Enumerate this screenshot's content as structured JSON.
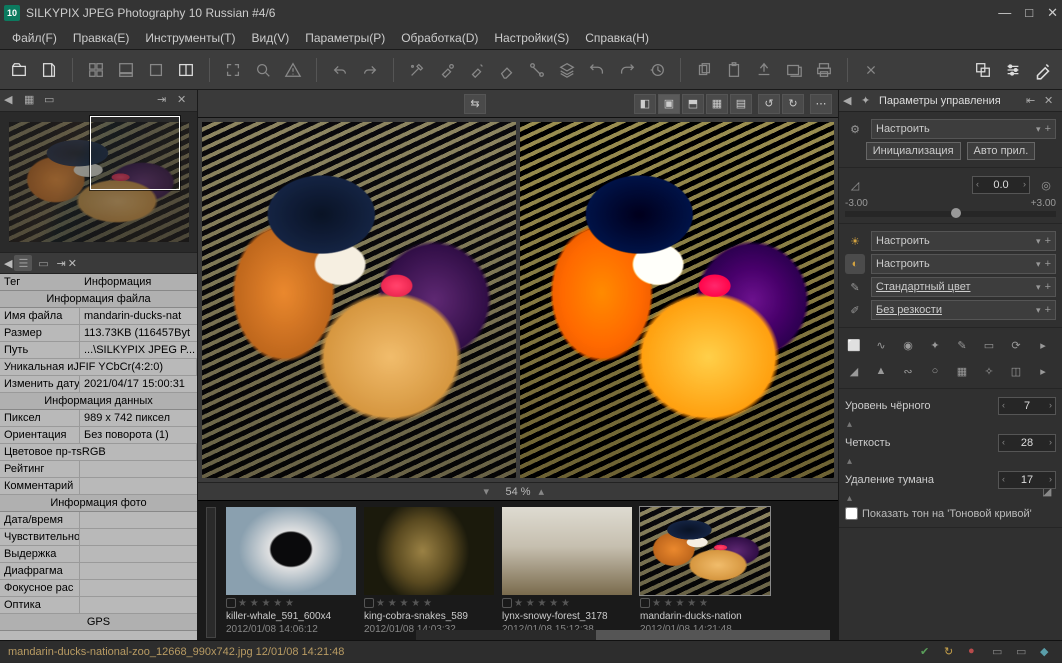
{
  "title": "SILKYPIX JPEG Photography 10 Russian   #4/6",
  "app_badge": "10",
  "menu": {
    "file": "Файл(F)",
    "edit": "Правка(E)",
    "tools": "Инструменты(T)",
    "view": "Вид(V)",
    "params": "Параметры(P)",
    "process": "Обработка(D)",
    "settings": "Настройки(S)",
    "help": "Справка(H)"
  },
  "zoom": {
    "value": "54",
    "unit": "%"
  },
  "info": {
    "col1": "Тег",
    "col2": "Информация",
    "sec_file": "Информация файла",
    "filename_k": "Имя файла",
    "filename_v": "mandarin-ducks-nat",
    "size_k": "Размер",
    "size_v": "113.73KB (116457Byt",
    "path_k": "Путь",
    "path_v": "...\\SILKYPIX JPEG P...",
    "uniq_k": "Уникальная иJFIF YCbCr(4:2:0)",
    "uniq_v": "",
    "mdate_k": "Изменить дату",
    "mdate_v": "2021/04/17 15:00:31",
    "sec_data": "Информация данных",
    "px_k": "Пиксел",
    "px_v": "989 x 742 пиксел",
    "orient_k": "Ориентация",
    "orient_v": "Без поворота (1)",
    "cs_k": "Цветовое пр-тsRGB",
    "cs_v": "",
    "rating_k": "Рейтинг",
    "rating_v": "",
    "comment_k": "Комментарий",
    "comment_v": "",
    "sec_photo": "Информация фото",
    "dt_k": "Дата/время",
    "dt_v": "",
    "sens_k": "Чувствительно",
    "sens_v": "",
    "exp_k": "Выдержка",
    "exp_v": "",
    "ap_k": "Диафрагма",
    "ap_v": "",
    "foc_k": "Фокусное рас",
    "foc_v": "",
    "opt_k": "Оптика",
    "opt_v": "",
    "sec_gps": "GPS"
  },
  "strip": [
    {
      "name": "killer-whale_591_600x4",
      "date": "2012/01/08 14:06:12"
    },
    {
      "name": "king-cobra-snakes_589",
      "date": "2012/01/08 14:03:32"
    },
    {
      "name": "lynx-snowy-forest_3178",
      "date": "2012/01/08 15:12:38"
    },
    {
      "name": "mandarin-ducks-nation",
      "date": "2012/01/08 14:21:48"
    }
  ],
  "right": {
    "title": "Параметры управления",
    "preset": "Настроить",
    "init_btn": "Инициализация",
    "auto_btn": "Авто прил.",
    "exp_value": "0.0",
    "exp_min": "-3.00",
    "exp_max": "+3.00",
    "wb": "Настроить",
    "tone": "Настроить",
    "color": "Стандартный цвет",
    "sharp": "Без резкости",
    "black_k": "Уровень чёрного",
    "black_v": "7",
    "clarity_k": "Четкость",
    "clarity_v": "28",
    "dehaze_k": "Удаление тумана",
    "dehaze_v": "17",
    "show_tone": "Показать тон на 'Тоновой кривой'"
  },
  "status": {
    "text": "mandarin-ducks-national-zoo_12668_990x742.jpg 12/01/08 14:21:48"
  }
}
